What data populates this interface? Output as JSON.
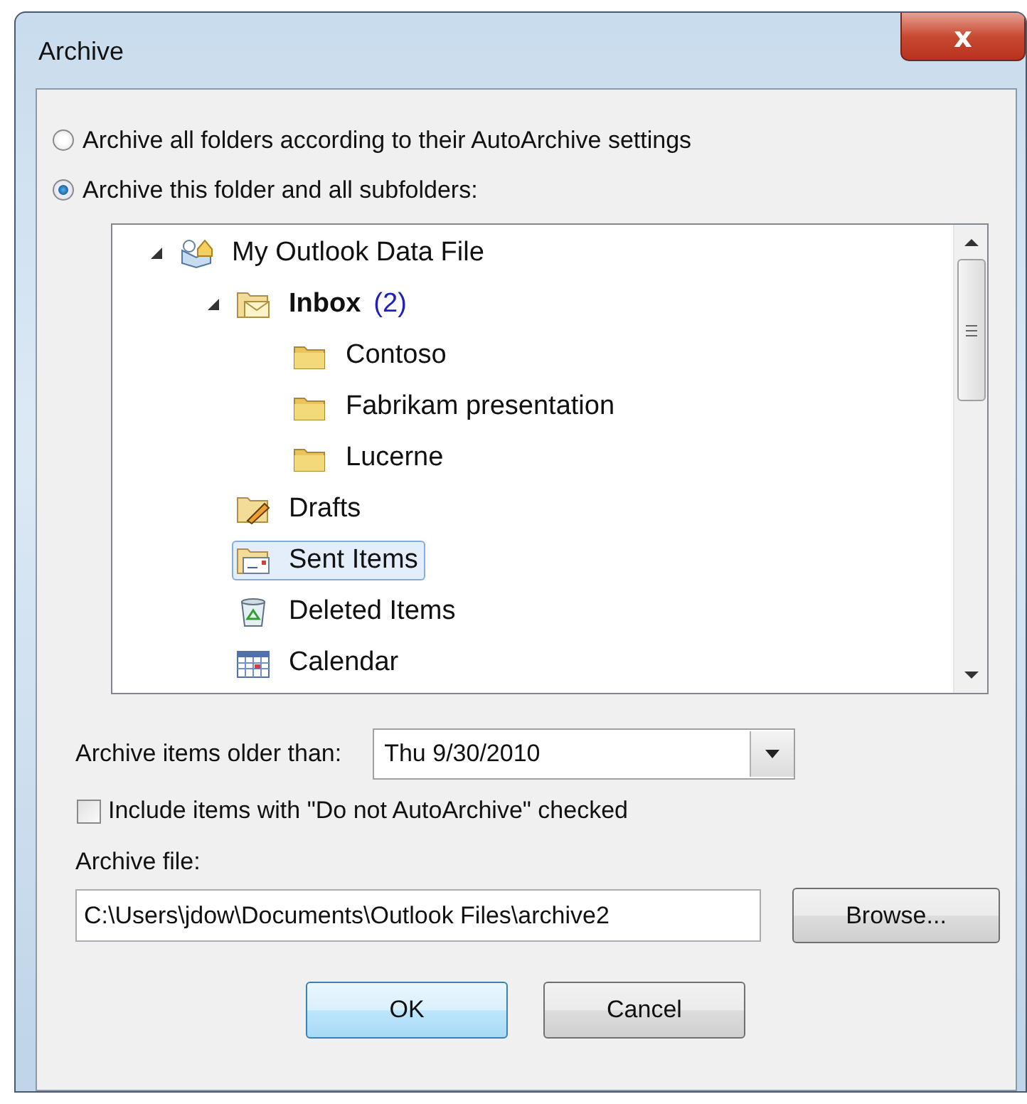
{
  "window": {
    "title": "Archive",
    "close_label": "x"
  },
  "scope_options": [
    {
      "label": "Archive all folders according to their AutoArchive settings",
      "selected": false
    },
    {
      "label": "Archive this folder and all subfolders:",
      "selected": true
    }
  ],
  "folder_tree": [
    {
      "label": "My Outlook Data File",
      "kind": "data-file",
      "expanded": true,
      "selected": false,
      "unread": false,
      "children": [
        {
          "label": "Inbox",
          "count": "(2)",
          "kind": "inbox",
          "expanded": true,
          "selected": false,
          "unread": true,
          "children": [
            {
              "label": "Contoso",
              "kind": "folder",
              "selected": false,
              "unread": false
            },
            {
              "label": "Fabrikam presentation",
              "kind": "folder",
              "selected": false,
              "unread": false
            },
            {
              "label": "Lucerne",
              "kind": "folder",
              "selected": false,
              "unread": false
            }
          ]
        },
        {
          "label": "Drafts",
          "kind": "drafts",
          "selected": false,
          "unread": false
        },
        {
          "label": "Sent Items",
          "kind": "sent",
          "selected": true,
          "unread": false
        },
        {
          "label": "Deleted Items",
          "kind": "deleted",
          "selected": false,
          "unread": false
        },
        {
          "label": "Calendar",
          "kind": "calendar",
          "selected": false,
          "unread": false
        }
      ]
    }
  ],
  "older_than": {
    "label": "Archive items older than:",
    "value": "Thu 9/30/2010"
  },
  "include_checkbox": {
    "label": "Include items with \"Do not AutoArchive\" checked",
    "checked": false
  },
  "archive_file": {
    "label": "Archive file:",
    "value": "C:\\Users\\jdow\\Documents\\Outlook Files\\archive2",
    "browse": "Browse..."
  },
  "buttons": [
    {
      "label": "OK",
      "default": true
    },
    {
      "label": "Cancel",
      "default": false
    }
  ]
}
